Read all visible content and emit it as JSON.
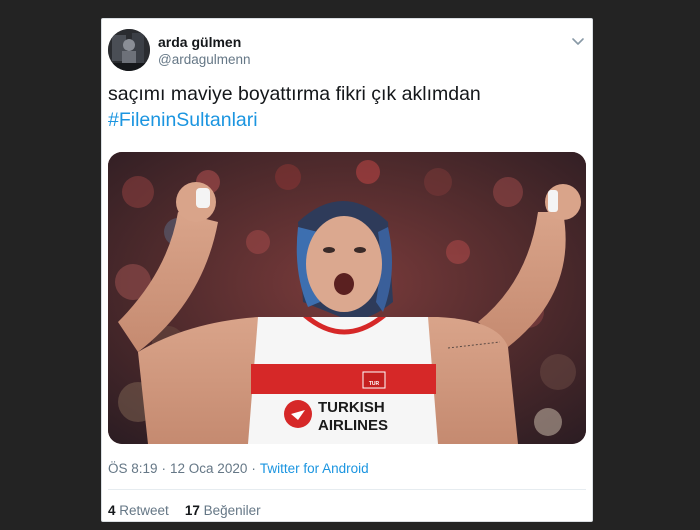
{
  "tweet": {
    "author_name": "arda gülmen",
    "author_handle": "@ardagulmenn",
    "text": "saçımı maviye boyattırma fikri çık aklımdan",
    "hashtag": "#FileninSultanlari",
    "time": "ÖS 8:19",
    "date": "12 Oca 2020",
    "separator": "·",
    "source": "Twitter for Android",
    "retweet_count": "4",
    "retweet_label": "Retweet",
    "like_count": "17",
    "like_label": "Beğeniler"
  },
  "photo": {
    "jersey_brand_line1": "TURKISH",
    "jersey_brand_line2": "AIRLINES",
    "flag_badge_label": "TUR"
  },
  "icons": {
    "avatar": "profile-avatar",
    "menu": "chevron-down-icon"
  },
  "colors": {
    "link": "#1b95e0",
    "muted": "#657786",
    "text": "#14171a",
    "backdrop": "#232323"
  }
}
